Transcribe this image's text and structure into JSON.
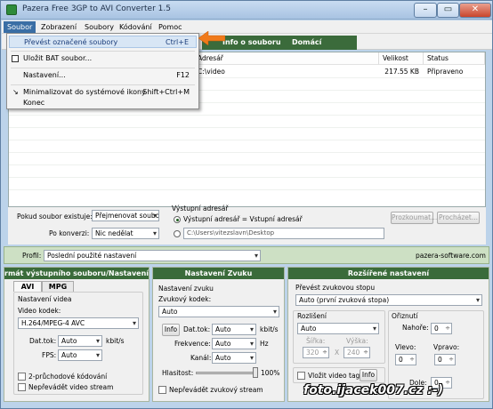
{
  "window": {
    "title": "Pazera Free 3GP to AVI Converter 1.5",
    "min": "–",
    "max": "▭",
    "close": "✕"
  },
  "menu": {
    "items": [
      "Soubor",
      "Zobrazení",
      "Soubory",
      "Kódování",
      "Pomoc"
    ]
  },
  "toolbar_tabs": [
    "Info o souboru",
    "Domácí stránka"
  ],
  "dropdown": {
    "items": [
      {
        "label": "Převést označené soubory",
        "shortcut": "Ctrl+E"
      },
      {
        "label": "Uložit BAT soubor...",
        "shortcut": ""
      },
      {
        "label": "Nastavení...",
        "shortcut": "F12"
      },
      {
        "label": "Minimalizovat do systémové ikony",
        "shortcut": "Shift+Ctrl+M"
      },
      {
        "label": "Konec",
        "shortcut": ""
      }
    ]
  },
  "filelist": {
    "columns": [
      "Adresář",
      "Velikost",
      "Status"
    ],
    "rows": [
      {
        "dir": "C:\\video",
        "size": "217.55 KB",
        "status": "Připraveno"
      }
    ]
  },
  "options": {
    "exists_label": "Pokud soubor existuje:",
    "exists_value": "Přejmenovat soubo",
    "after_label": "Po konverzi:",
    "after_value": "Nic nedělat",
    "outdir_label": "Výstupní adresář",
    "radio1": "Výstupní adresář = Vstupní adresář",
    "outdir_path": "C:\\Users\\vitezslavn\\Desktop",
    "browse": "Prozkoumat...",
    "view": "Procházet..."
  },
  "profile": {
    "label": "Profil:",
    "value": "Poslední použité nastavení",
    "site": "pazera-software.com"
  },
  "video_panel": {
    "header": "rmát výstupního souboru/Nastavení vid",
    "tabs": [
      "AVI",
      "MPG"
    ],
    "group": "Nastavení videa",
    "codec_label": "Video kodek:",
    "codec_value": "H.264/MPEG-4 AVC",
    "bitrate_label": "Dat.tok:",
    "bitrate_value": "Auto",
    "bitrate_unit": "kbit/s",
    "fps_label": "FPS:",
    "fps_value": "Auto",
    "twopass": "2-průchodové kódování",
    "novideo": "Nepřevádět video stream"
  },
  "audio_panel": {
    "header": "Nastavení Zvuku",
    "group": "Nastavení zvuku",
    "codec_label": "Zvukový kodek:",
    "codec_value": "Auto",
    "info": "Info",
    "bitrate_label": "Dat.tok:",
    "bitrate_value": "Auto",
    "bitrate_unit": "kbit/s",
    "freq_label": "Frekvence:",
    "freq_value": "Auto",
    "freq_unit": "Hz",
    "channels_label": "Kanál:",
    "channels_value": "Auto",
    "volume_label": "Hlasitost:",
    "volume_value": "100%",
    "volume_level": 1.0,
    "noaudio": "Nepřevádět zvukový stream"
  },
  "adv_panel": {
    "header": "Rozšířené nastavení",
    "track_label": "Převést zvukovou stopu",
    "track_value": "Auto (první zvuková stopa)",
    "res_label": "Rozlišení",
    "res_value": "Auto",
    "w_label": "Šířka:",
    "h_label": "Výška:",
    "w_value": "320",
    "x": "X",
    "h_value": "240",
    "crop_label": "Ořiznutí",
    "top_label": "Nahoře:",
    "top_value": "0",
    "left_label": "Vlevo:",
    "left_value": "0",
    "right_label": "Vpravo:",
    "right_value": "0",
    "bottom_label": "Dole:",
    "bottom_value": "0",
    "insert_tag": "Vložit video tag",
    "info": "Info"
  },
  "watermark": "foto.ijacek007.cz :-)",
  "colors": {
    "accent_green": "#3a6b3a",
    "menu_highlight": "#3a6ea5",
    "arrow": "#f07a1a"
  }
}
